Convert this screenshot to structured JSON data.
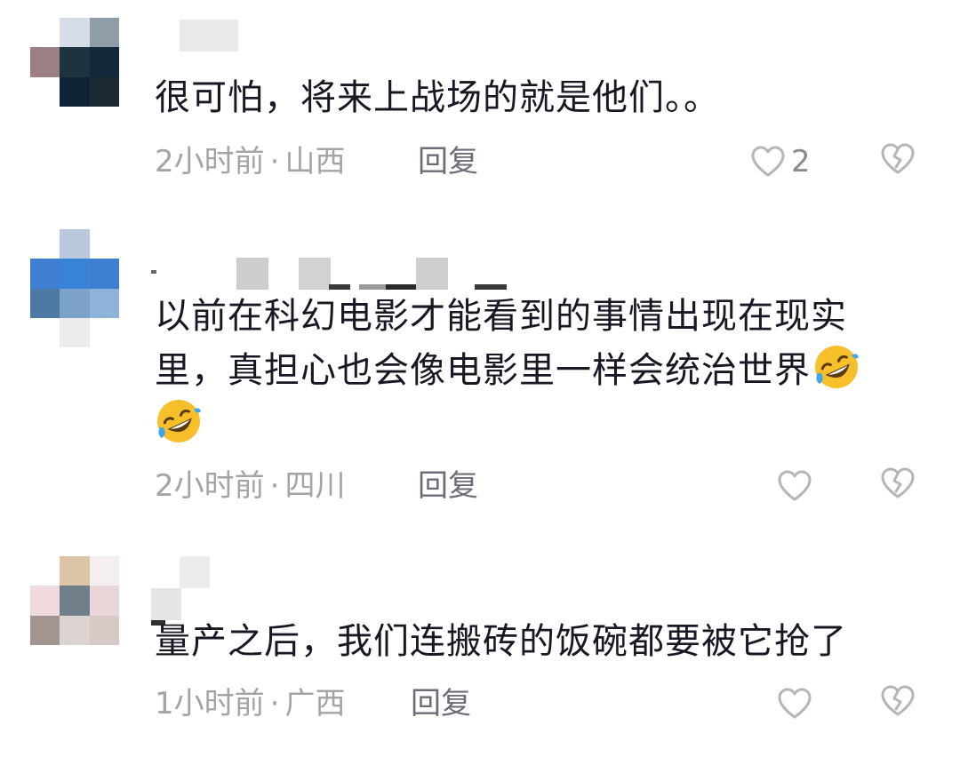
{
  "comments": [
    {
      "text": "很可怕，将来上战场的就是他们。。",
      "time": "2小时前",
      "location": "山西",
      "reply_label": "回复",
      "like_count": "2"
    },
    {
      "text": "以前在科幻电影才能看到的事情出现在现实里，真担心也会像电影里一样会统治世界",
      "time": "2小时前",
      "location": "四川",
      "reply_label": "回复",
      "like_count": ""
    },
    {
      "text": "量产之后，我们连搬砖的饭碗都要被它抢了",
      "time": "1小时前",
      "location": "广西",
      "reply_label": "回复",
      "like_count": ""
    }
  ],
  "meta_separator": "·",
  "icons": {
    "like": "heart-outline-icon",
    "dislike": "broken-heart-icon",
    "emoji": "rolling-on-floor-laughing-emoji"
  },
  "colors": {
    "text": "#161823",
    "meta": "#a3a3a8",
    "reply": "#6b6e78",
    "icon": "#b4b5ba"
  }
}
